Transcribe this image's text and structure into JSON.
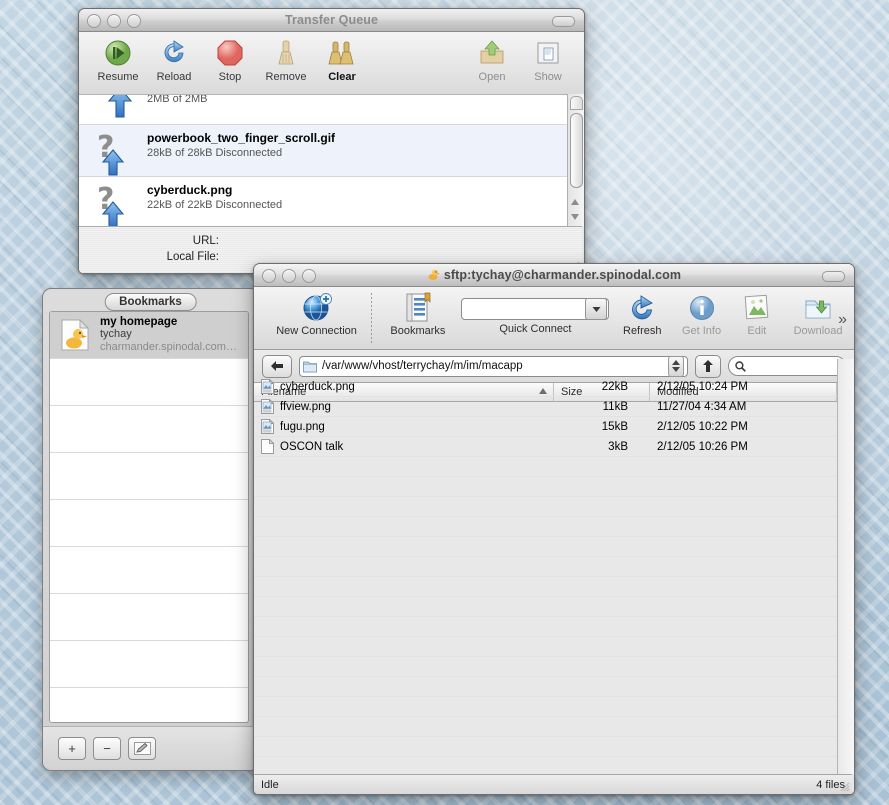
{
  "desktop": {
    "bg_color": "#b4cadb"
  },
  "queue_window": {
    "title": "Transfer Queue",
    "toolbar": {
      "left_items": [
        {
          "label": "Resume",
          "icon": "resume-play-icon",
          "state": "normal"
        },
        {
          "label": "Reload",
          "icon": "reload-arrow-icon",
          "state": "normal"
        },
        {
          "label": "Stop",
          "icon": "stop-octagon-icon",
          "state": "normal"
        },
        {
          "label": "Remove",
          "icon": "broom-icon",
          "state": "normal"
        },
        {
          "label": "Clear",
          "icon": "double-broom-icon",
          "state": "bold"
        }
      ],
      "right_items": [
        {
          "label": "Open",
          "icon": "open-box-icon",
          "state": "dim"
        },
        {
          "label": "Show",
          "icon": "show-document-icon",
          "state": "dim"
        }
      ]
    },
    "transfers": [
      {
        "name": "",
        "detail": "2MB of 2MB",
        "icon": "upload-arrow-icon",
        "selected": false,
        "partial": true
      },
      {
        "name": "powerbook_two_finger_scroll.gif",
        "detail": "28kB of 28kB  Disconnected",
        "icon": "unknown-upload-icon",
        "selected": true,
        "partial": false
      },
      {
        "name": "cyberduck.png",
        "detail": "22kB of 22kB  Disconnected",
        "icon": "unknown-upload-icon",
        "selected": false,
        "partial": false
      }
    ],
    "info": {
      "url_label": "URL:",
      "url_value": "",
      "local_label": "Local File:",
      "local_value": ""
    }
  },
  "bookmarks_drawer": {
    "tab_label": "Bookmarks",
    "items": [
      {
        "title": "my homepage",
        "user": "tychay",
        "host": "charmander.spinodal.com…",
        "icon": "duck-bookmark-icon",
        "selected": true
      }
    ],
    "empty_row_count": 8,
    "buttons": [
      {
        "label": "+",
        "name": "add-bookmark-button"
      },
      {
        "label": "−",
        "name": "remove-bookmark-button"
      },
      {
        "label": "✎",
        "name": "edit-bookmark-button"
      }
    ]
  },
  "browser_window": {
    "title": "sftp:tychay@charmander.spinodal.com",
    "title_icon": "duck-icon",
    "toolbar": [
      {
        "label": "New Connection",
        "icon": "globe-plus-icon",
        "state": "normal"
      },
      {
        "label": "Bookmarks",
        "icon": "bookmarks-list-icon",
        "state": "normal"
      },
      {
        "label": "Quick Connect",
        "icon": "quick-connect-combo",
        "state": "normal"
      },
      {
        "label": "Refresh",
        "icon": "refresh-arrow-icon",
        "state": "normal"
      },
      {
        "label": "Get Info",
        "icon": "info-circle-icon",
        "state": "dim"
      },
      {
        "label": "Edit",
        "icon": "edit-picture-icon",
        "state": "dim"
      },
      {
        "label": "Download",
        "icon": "download-folder-icon",
        "state": "dim"
      }
    ],
    "overflow_label": "»",
    "quick_connect": {
      "value": "",
      "placeholder": ""
    },
    "pathbar": {
      "back_icon": "back-arrow-icon",
      "folder_icon": "folder-icon",
      "path": "/var/www/vhost/terrychay/m/im/macapp",
      "up_icon": "up-arrow-icon",
      "search_icon": "search-icon",
      "search_value": "",
      "search_placeholder": ""
    },
    "columns": [
      {
        "label": "Filename",
        "sorted": true
      },
      {
        "label": "Size",
        "sorted": false
      },
      {
        "label": "Modified",
        "sorted": false
      }
    ],
    "files": [
      {
        "name": "cyberduck.png",
        "size": "22kB",
        "modified": "2/12/05 10:24 PM",
        "icon": "png-file-icon"
      },
      {
        "name": "ffview.png",
        "size": "11kB",
        "modified": "11/27/04 4:34 AM",
        "icon": "png-file-icon"
      },
      {
        "name": "fugu.png",
        "size": "15kB",
        "modified": "2/12/05 10:22 PM",
        "icon": "png-file-icon"
      },
      {
        "name": "OSCON talk",
        "size": "3kB",
        "modified": "2/12/05 10:26 PM",
        "icon": "generic-file-icon"
      }
    ],
    "empty_row_count": 16,
    "status": {
      "left": "Idle",
      "right": "4 files"
    }
  }
}
